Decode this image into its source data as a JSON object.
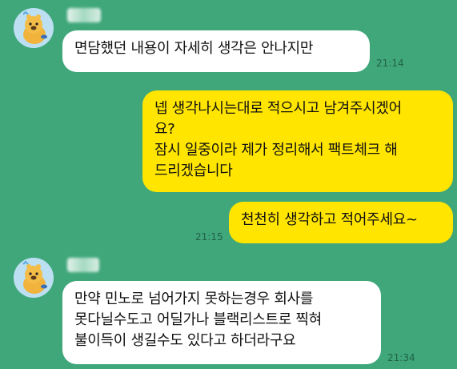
{
  "colors": {
    "background": "#3fa77a",
    "incoming_bubble": "#ffffff",
    "outgoing_bubble": "#ffe500"
  },
  "messages": [
    {
      "direction": "in",
      "text": "면담했던 내용이 자세히 생각은 안나지만",
      "time": "21:14"
    },
    {
      "direction": "out",
      "text": "넵 생각나시는대로 적으시고 남겨주시겠어\n요?\n잠시 일중이라 제가 정리해서 팩트체크 해\n드리겠습니다"
    },
    {
      "direction": "out",
      "text": "천천히 생각하고 적어주세요~",
      "time": "21:15"
    },
    {
      "direction": "in",
      "text": "만약 민노로 넘어가지 못하는경우 회사를\n못다닐수도고 어딜가나 블랙리스트로 찍혀\n불이득이 생길수도 있다고 하더라구요",
      "time": "21:34"
    }
  ],
  "icons": {
    "avatar": "otter-character-avatar-icon"
  }
}
